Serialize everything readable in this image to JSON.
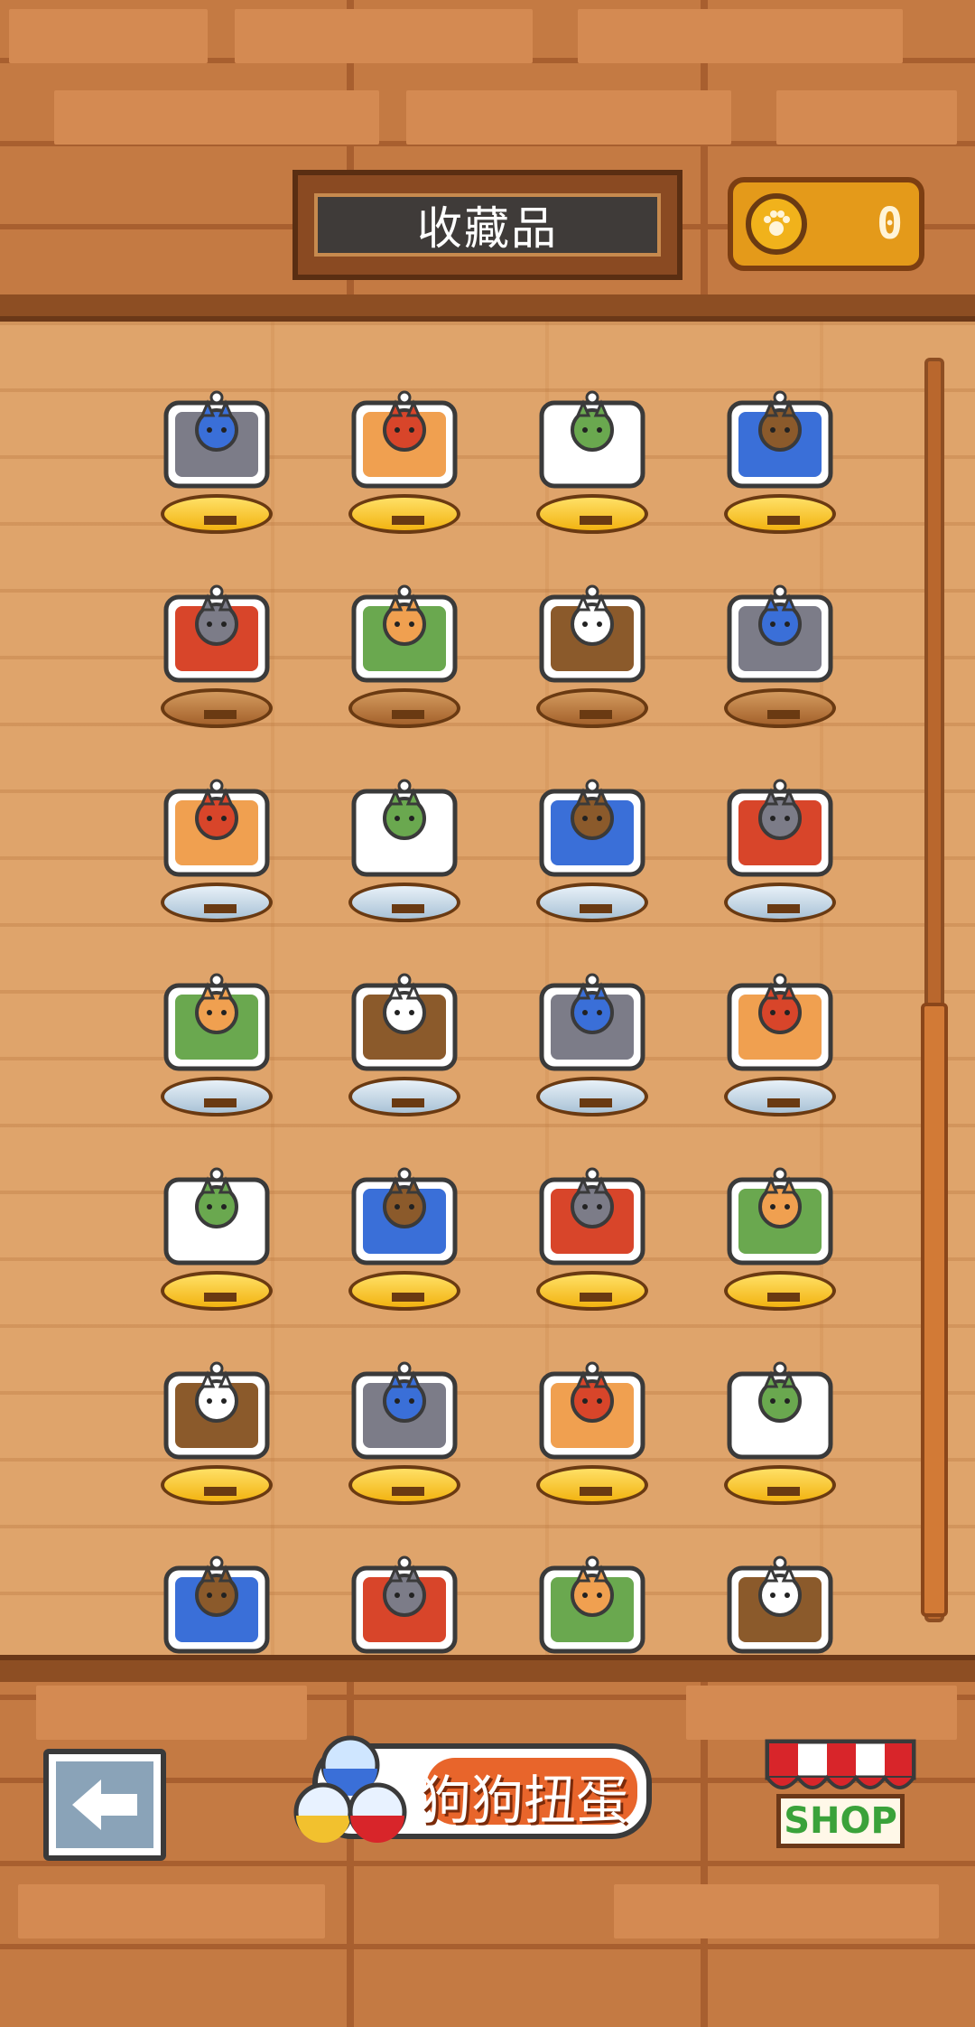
{
  "header": {
    "title": "收藏品",
    "coin_count": "0",
    "coin_icon": "paw-coin-icon"
  },
  "collection": {
    "rows": [
      [
        {
          "name": "cat-tea-set",
          "pedestal": "gold"
        },
        {
          "name": "cat-snow-globe-red",
          "pedestal": "gold"
        },
        {
          "name": "cat-golden-bed",
          "pedestal": "gold"
        },
        {
          "name": "cats-in-bowls",
          "pedestal": "gold"
        }
      ],
      [
        {
          "name": "cat-lying",
          "pedestal": "bronze"
        },
        {
          "name": "cat-lamp-post",
          "pedestal": "bronze"
        },
        {
          "name": "cat-wardrobe",
          "pedestal": "bronze"
        },
        {
          "name": "cat-plant-table",
          "pedestal": "bronze"
        }
      ],
      [
        {
          "name": "cat-window",
          "pedestal": "silver"
        },
        {
          "name": "cat-pair-cushions",
          "pedestal": "silver"
        },
        {
          "name": "cat-sofa",
          "pedestal": "silver"
        },
        {
          "name": "cat-round-window",
          "pedestal": "silver"
        }
      ],
      [
        {
          "name": "cat-arched-door",
          "pedestal": "silver"
        },
        {
          "name": "cat-armchair",
          "pedestal": "silver"
        },
        {
          "name": "cat-tv-stand",
          "pedestal": "silver"
        },
        {
          "name": "cat-blue-bed",
          "pedestal": "silver"
        }
      ],
      [
        {
          "name": "cat-fireplace",
          "pedestal": "gold"
        },
        {
          "name": "cat-dinner-table",
          "pedestal": "gold"
        },
        {
          "name": "cat-snow-globe-blue",
          "pedestal": "gold"
        },
        {
          "name": "cat-bathtub",
          "pedestal": "gold"
        }
      ],
      [
        {
          "name": "cat-wizard-hat",
          "pedestal": "gold"
        },
        {
          "name": "cat-moon",
          "pedestal": "gold"
        },
        {
          "name": "cat-parachute-orange",
          "pedestal": "gold"
        },
        {
          "name": "cat-parachute-grey",
          "pedestal": "gold"
        }
      ],
      [
        {
          "name": "cat-box-sled",
          "pedestal": "gold"
        },
        {
          "name": "cat-red-chair",
          "pedestal": "rainbow"
        },
        {
          "name": "cat-lying-toy",
          "pedestal": "rainbow"
        },
        {
          "name": "cat-detective",
          "pedestal": "rainbow"
        }
      ]
    ]
  },
  "footer": {
    "back_icon": "arrow-left-icon",
    "gacha_label": "狗狗扭蛋",
    "shop_label": "SHOP"
  },
  "colors": {
    "wall": "#c47a43",
    "shelf": "#dfa46b",
    "gold": "#f2b311",
    "accent_orange": "#e8652b",
    "shop_green": "#3aa23a"
  }
}
